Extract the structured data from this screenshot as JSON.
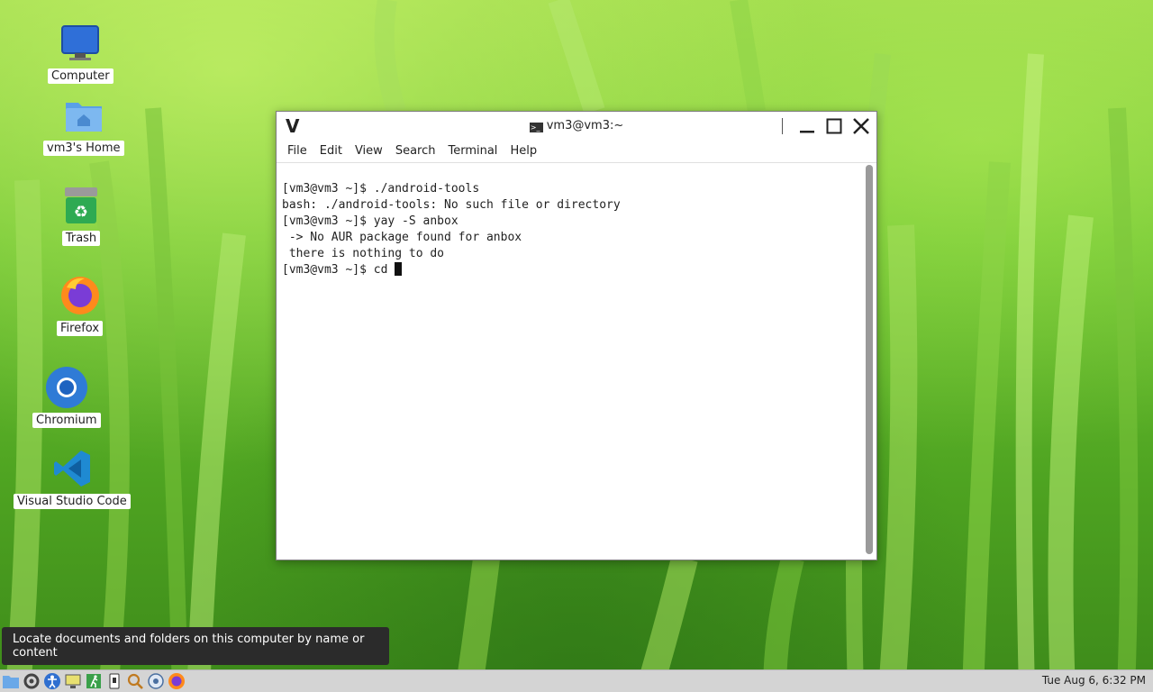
{
  "desktop": {
    "icons": [
      {
        "label": "Computer",
        "icon": "monitor-icon"
      },
      {
        "label": "vm3's Home",
        "icon": "home-folder-icon"
      },
      {
        "label": "Trash",
        "icon": "trash-icon"
      },
      {
        "label": "Firefox",
        "icon": "firefox-icon"
      },
      {
        "label": "Chromium",
        "icon": "chromium-icon"
      },
      {
        "label": "Visual Studio Code",
        "icon": "vscode-icon"
      }
    ]
  },
  "window": {
    "title": "vm3@vm3:~",
    "app_logo": "V",
    "menu": [
      "File",
      "Edit",
      "View",
      "Search",
      "Terminal",
      "Help"
    ],
    "terminal_lines": [
      "[vm3@vm3 ~]$ ./android-tools",
      "bash: ./android-tools: No such file or directory",
      "[vm3@vm3 ~]$ yay -S anbox",
      " -> No AUR package found for anbox",
      " there is nothing to do"
    ],
    "prompt_line": "[vm3@vm3 ~]$ cd "
  },
  "tooltip": {
    "text": "Locate documents and folders on this computer by name or content"
  },
  "taskbar": {
    "icons": [
      "file-manager-icon",
      "settings-icon",
      "accessibility-icon",
      "monitor-settings-icon",
      "exit-icon",
      "terminal-icon",
      "search-icon",
      "network-icon",
      "firefox-icon"
    ],
    "clock": "Tue Aug  6, 6:32 PM"
  },
  "colors": {
    "accent_green": "#6cc330",
    "tooltip_bg": "#2b2b2b",
    "taskbar_bg": "#d4d4d4"
  }
}
